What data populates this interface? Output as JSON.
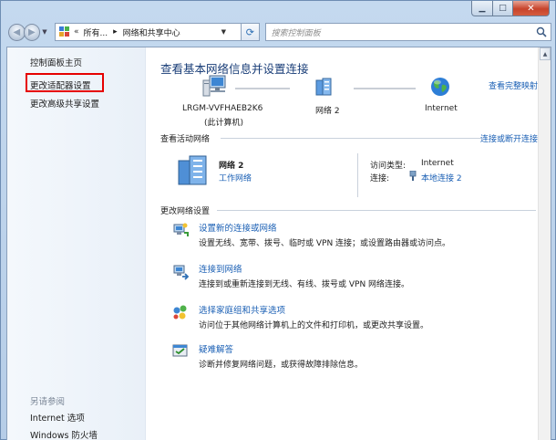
{
  "window": {
    "minimize_glyph": "▁",
    "maximize_glyph": "□",
    "close_glyph": "✕"
  },
  "address_bar": {
    "chevron": "«",
    "segment_1": "所有...",
    "separator": "▸",
    "segment_2": "网络和共享中心",
    "search_placeholder": "搜索控制面板"
  },
  "sidebar": {
    "items": [
      {
        "label": "控制面板主页"
      },
      {
        "label": "更改适配器设置"
      },
      {
        "label": "更改高级共享设置"
      }
    ],
    "see_also_heading": "另请参阅",
    "see_also_items": [
      {
        "label": "Internet 选项"
      },
      {
        "label": "Windows 防火墙"
      }
    ]
  },
  "main": {
    "title": "查看基本网络信息并设置连接",
    "full_map_link": "查看完整映射",
    "network_map": {
      "computer_name": "LRGM-VVFHAEB2K6",
      "computer_sub": "(此计算机)",
      "network_name": "网络  2",
      "internet_label": "Internet"
    },
    "active_networks_heading": "查看活动网络",
    "connect_disconnect_link": "连接或断开连接",
    "active_network": {
      "name": "网络  2",
      "type": "工作网络",
      "access_type_label": "访问类型:",
      "access_type_value": "Internet",
      "connection_label": "连接:",
      "connection_value": "本地连接 2"
    },
    "change_settings_heading": "更改网络设置",
    "tasks": [
      {
        "title": "设置新的连接或网络",
        "desc": "设置无线、宽带、拨号、临时或 VPN 连接；或设置路由器或访问点。"
      },
      {
        "title": "连接到网络",
        "desc": "连接到或重新连接到无线、有线、拨号或 VPN 网络连接。"
      },
      {
        "title": "选择家庭组和共享选项",
        "desc": "访问位于其他网络计算机上的文件和打印机，或更改共享设置。"
      },
      {
        "title": "疑难解答",
        "desc": "诊断并修复网络问题，或获得故障排除信息。"
      }
    ]
  },
  "colors": {
    "link": "#1a5fb4",
    "title": "#1a3e78",
    "highlight_box": "#e60000"
  }
}
